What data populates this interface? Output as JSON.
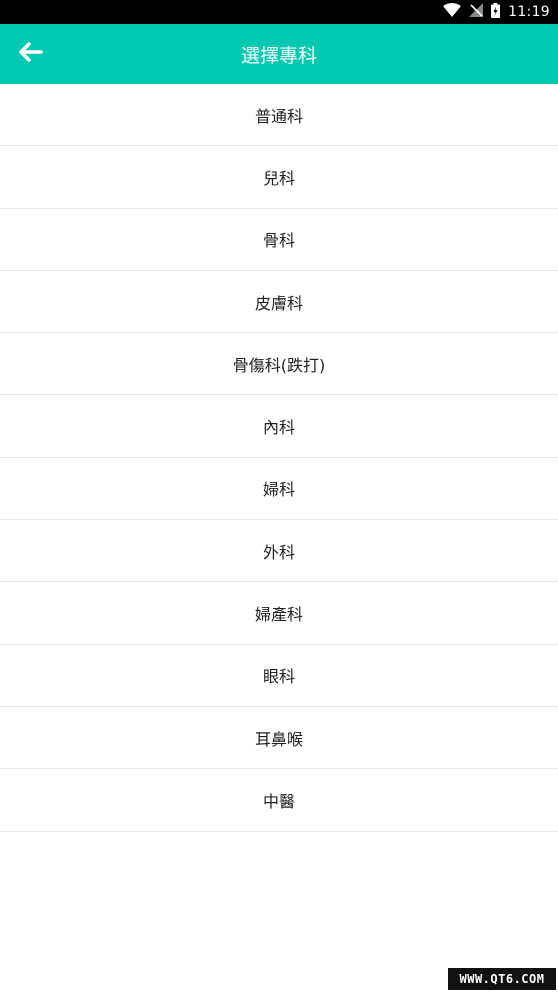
{
  "status_bar": {
    "time": "11:19",
    "icons": [
      "wifi-icon",
      "no-signal-icon",
      "battery-charging-icon"
    ]
  },
  "app_bar": {
    "title": "選擇專科",
    "back_icon": "arrow-left-icon"
  },
  "specialties": [
    {
      "label": "普通科"
    },
    {
      "label": "兒科"
    },
    {
      "label": "骨科"
    },
    {
      "label": "皮膚科"
    },
    {
      "label": "骨傷科(跌打)"
    },
    {
      "label": "內科"
    },
    {
      "label": "婦科"
    },
    {
      "label": "外科"
    },
    {
      "label": "婦產科"
    },
    {
      "label": "眼科"
    },
    {
      "label": "耳鼻喉"
    },
    {
      "label": "中醫"
    }
  ],
  "watermark": "WWW.QT6.COM",
  "colors": {
    "accent": "#00c9b1",
    "status_bar": "#000000",
    "divider": "#e8e8e8",
    "text": "#222222"
  }
}
